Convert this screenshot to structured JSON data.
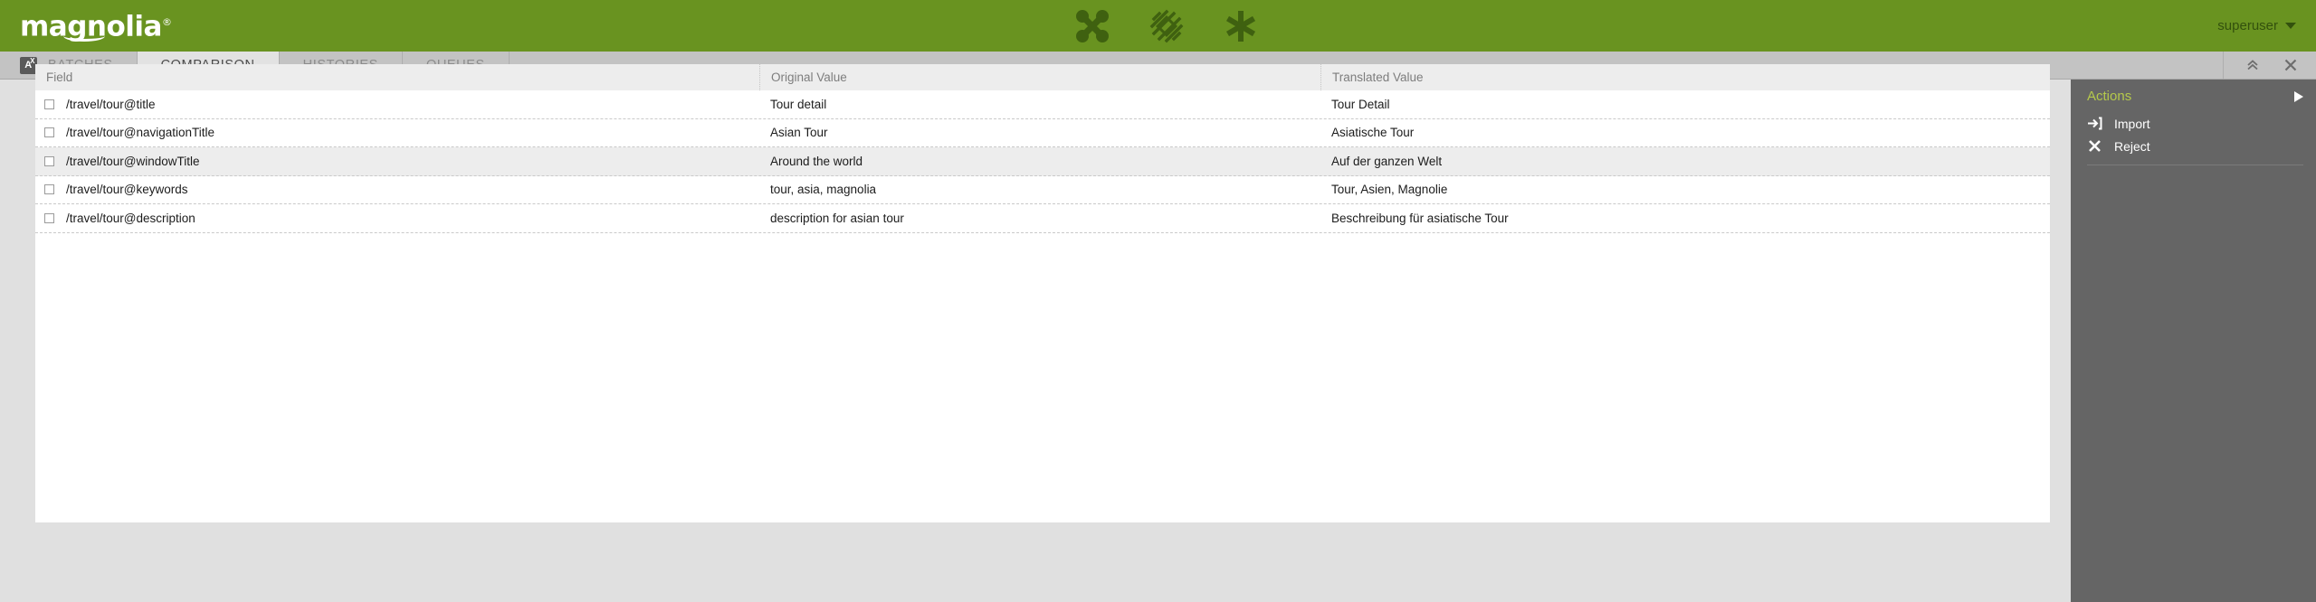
{
  "header": {
    "logo_text": "magnolia",
    "logo_mark": "®",
    "icons": [
      {
        "name": "pages-app-icon",
        "label": "pages"
      },
      {
        "name": "assets-app-icon",
        "label": "assets"
      },
      {
        "name": "asterisk-app-icon",
        "label": "asterisk"
      }
    ],
    "user": {
      "name": "superuser",
      "caret": "caret-down-icon"
    }
  },
  "tabs": [
    {
      "label": "BATCHES",
      "icon": "translate-badge-icon",
      "icon_letter": "A",
      "icon_sup": "X",
      "active": false
    },
    {
      "label": "COMPARISON",
      "icon": null,
      "active": true
    },
    {
      "label": "HISTORIES",
      "icon": null,
      "active": false
    },
    {
      "label": "QUEUES",
      "icon": null,
      "active": false
    }
  ],
  "tab_tools": [
    {
      "name": "collapse-icon",
      "glyph": "«"
    },
    {
      "name": "close-icon",
      "glyph": "✕"
    }
  ],
  "toolbar": {
    "menu_label": "hamburger-menu-icon"
  },
  "table": {
    "columns": [
      "Field",
      "Original Value",
      "Translated Value"
    ],
    "rows": [
      {
        "field": "/travel/tour@title",
        "original": "Tour detail",
        "translated": "Tour Detail",
        "checked": false,
        "highlighted": false
      },
      {
        "field": "/travel/tour@navigationTitle",
        "original": "Asian Tour",
        "translated": "Asiatische Tour",
        "checked": false,
        "highlighted": false
      },
      {
        "field": "/travel/tour@windowTitle",
        "original": "Around the world",
        "translated": "Auf der ganzen Welt",
        "checked": false,
        "highlighted": true
      },
      {
        "field": "/travel/tour@keywords",
        "original": "tour, asia, magnolia",
        "translated": "Tour, Asien, Magnolie",
        "checked": false,
        "highlighted": false
      },
      {
        "field": "/travel/tour@description",
        "original": "description for asian tour",
        "translated": "Beschreibung für asiatische Tour",
        "checked": false,
        "highlighted": false
      }
    ]
  },
  "actions": {
    "title": "Actions",
    "expander": "play-triangle-icon",
    "items": [
      {
        "label": "Import",
        "icon": "import-arrow-icon"
      },
      {
        "label": "Reject",
        "icon": "x-mark-icon"
      }
    ]
  },
  "colors": {
    "brand_green": "#699320",
    "header_dark_green": "#33510d",
    "tabbar_gray": "#c3c3c3",
    "active_tab_gray": "#e2e2e2",
    "content_gray": "#e0e0e0",
    "table_header_gray": "#ededed",
    "row_highlight_gray": "#ededed",
    "actions_panel_gray": "#656565",
    "actions_title_green": "#b5c94b"
  }
}
